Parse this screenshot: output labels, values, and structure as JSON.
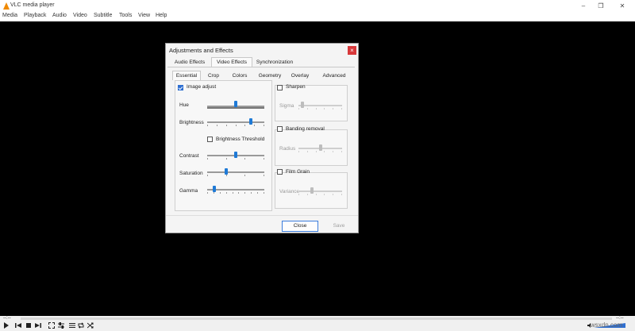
{
  "app": {
    "title": "VLC media player"
  },
  "window_controls": {
    "minimize": "–",
    "maximize": "❐",
    "close": "✕"
  },
  "menu": [
    "Media",
    "Playback",
    "Audio",
    "Video",
    "Subtitle",
    "Tools",
    "View",
    "Help"
  ],
  "dialog": {
    "title": "Adjustments and Effects",
    "close": "×",
    "main_tabs": [
      "Audio Effects",
      "Video Effects",
      "Synchronization"
    ],
    "sub_tabs": [
      "Essential",
      "Crop",
      "Colors",
      "Geometry",
      "Overlay",
      "Advanced"
    ],
    "image_adjust": {
      "label": "Image adjust",
      "checked": true,
      "hue": {
        "label": "Hue",
        "value": 0.5
      },
      "brightness": {
        "label": "Brightness",
        "value": 0.78
      },
      "brightness_threshold": {
        "label": "Brightness Threshold",
        "checked": false
      },
      "contrast": {
        "label": "Contrast",
        "value": 0.5
      },
      "saturation": {
        "label": "Saturation",
        "value": 0.33
      },
      "gamma": {
        "label": "Gamma",
        "value": 0.1
      }
    },
    "sharpen": {
      "label": "Sharpen",
      "checked": false,
      "sigma": {
        "label": "Sigma",
        "value": 0.05
      }
    },
    "banding_removal": {
      "label": "Banding removal",
      "checked": false,
      "radius": {
        "label": "Radius",
        "value": 0.5
      }
    },
    "film_grain": {
      "label": "Film Grain",
      "checked": false,
      "variance": {
        "label": "Variance",
        "value": 0.3
      }
    },
    "buttons": {
      "close": "Close",
      "save": "Save"
    }
  },
  "player": {
    "elapsed": "--:--",
    "total": "--:--",
    "volume": 1.0
  },
  "watermark": "wsxdn.com"
}
